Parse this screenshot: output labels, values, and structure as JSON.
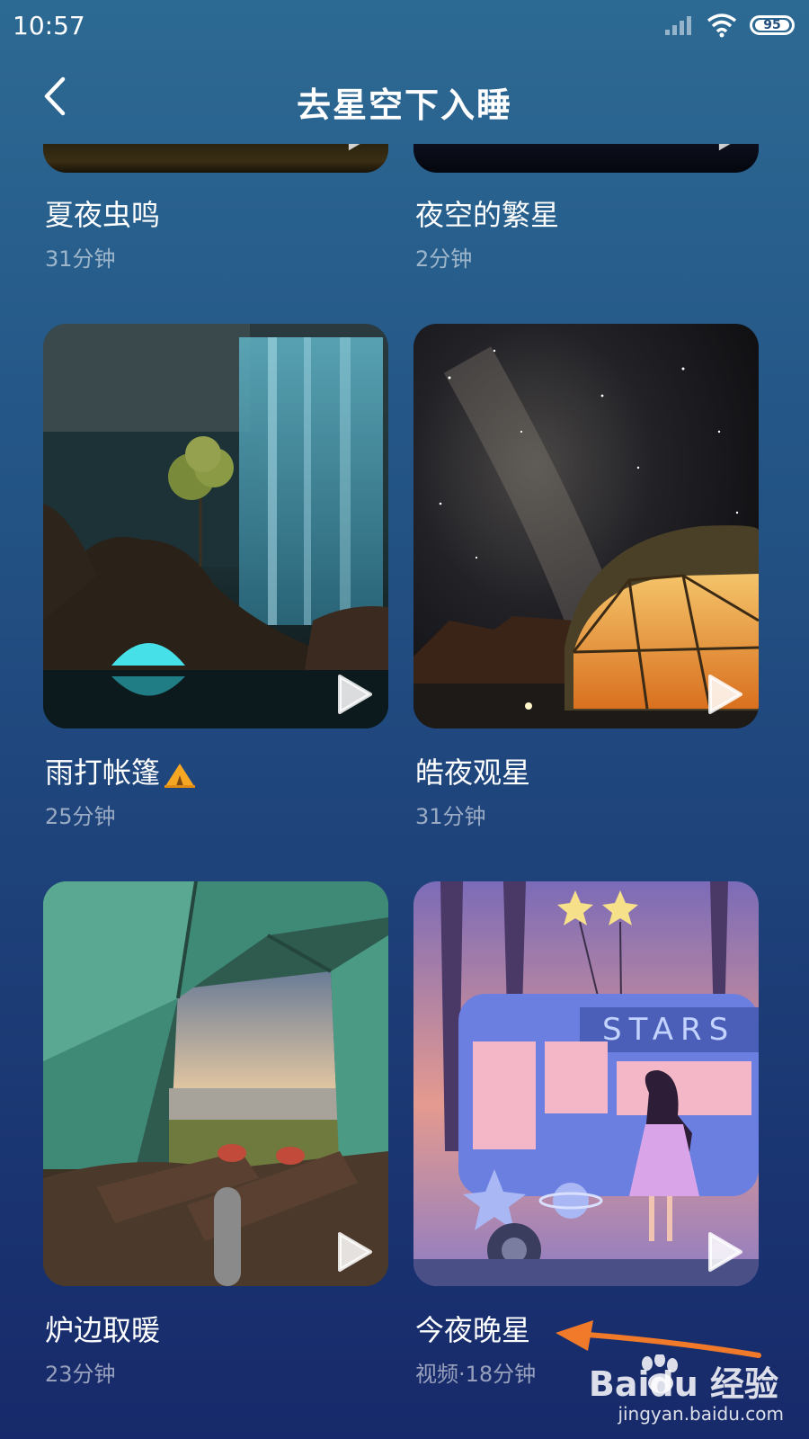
{
  "status_bar": {
    "time": "10:57",
    "battery": "95"
  },
  "header": {
    "title": "去星空下入睡"
  },
  "cards": [
    {
      "title": "夏夜虫鸣",
      "meta": "31分钟"
    },
    {
      "title": "夜空的繁星",
      "meta": "2分钟"
    },
    {
      "title": "雨打帐篷",
      "meta": "25分钟"
    },
    {
      "title": "皓夜观星",
      "meta": "31分钟"
    },
    {
      "title": "炉边取暖",
      "meta": "23分钟"
    },
    {
      "title": "今夜晚星",
      "meta": "视频·18分钟"
    }
  ],
  "watermark": {
    "brand": "Baidu 经验",
    "url": "jingyan.baidu.com"
  },
  "colors": {
    "background_top": "#2d6a93",
    "background_bottom": "#17296a",
    "annotation_arrow": "#f07a2a"
  }
}
